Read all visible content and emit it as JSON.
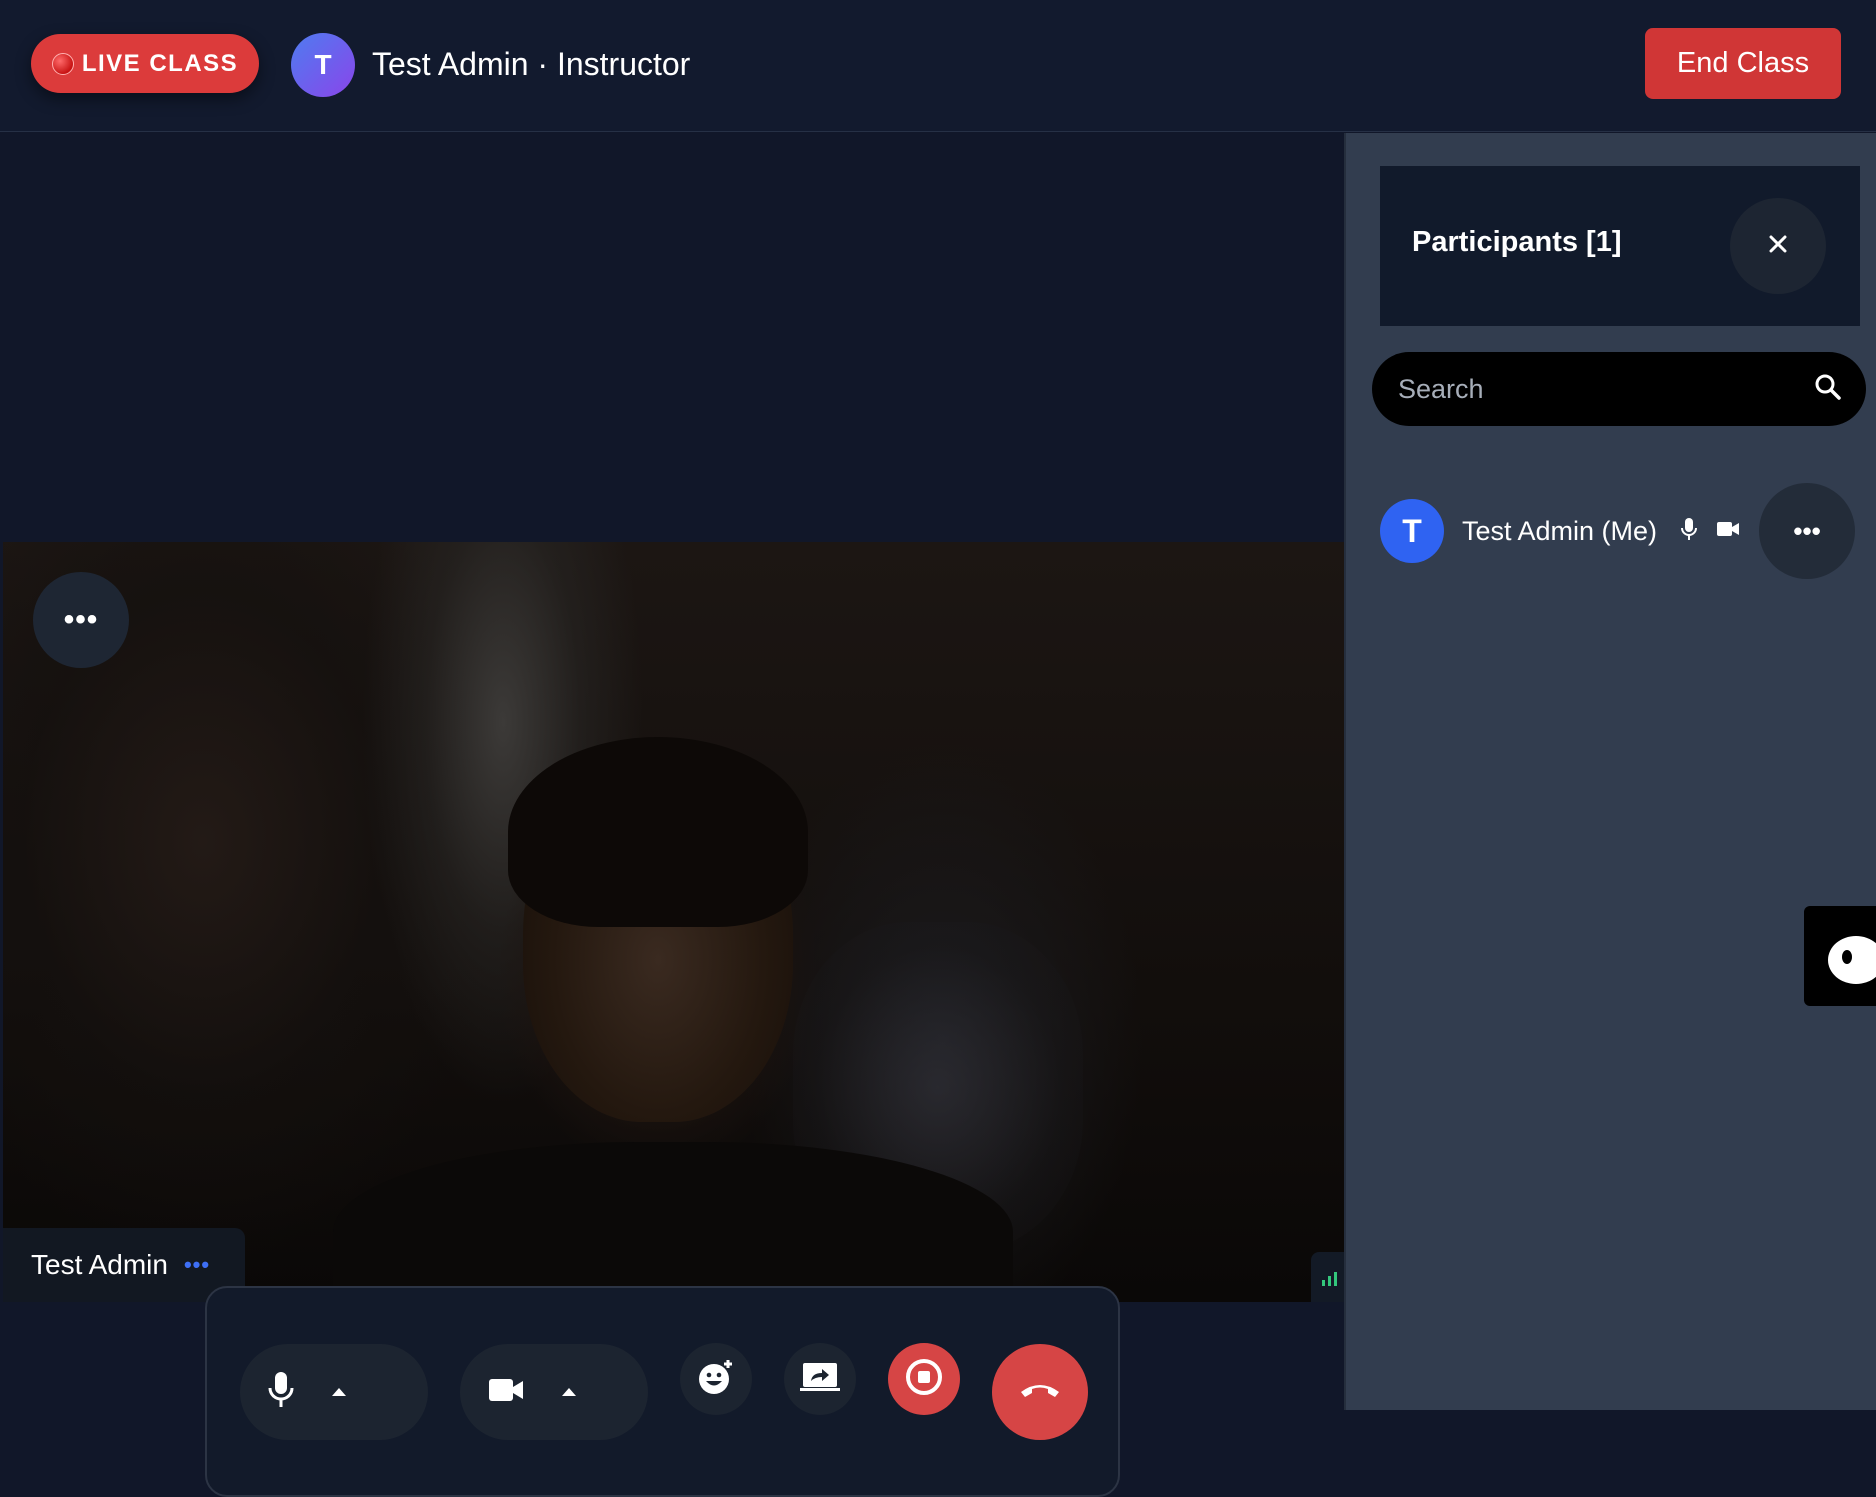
{
  "header": {
    "live_label": "LIVE CLASS",
    "avatar_initial": "T",
    "title": "Test Admin · Instructor",
    "end_class_label": "End Class"
  },
  "video": {
    "participant_name": "Test Admin",
    "menu_icon": "more-horizontal-icon",
    "name_menu_icon": "more-horizontal-icon",
    "signal_icon": "signal-strength-icon"
  },
  "controls": {
    "mic_icon": "microphone-icon",
    "mic_caret": "caret-up-icon",
    "camera_icon": "video-camera-icon",
    "camera_caret": "caret-up-icon",
    "reactions_icon": "emoji-add-icon",
    "share_icon": "screen-share-icon",
    "record_icon": "stop-record-icon",
    "leave_icon": "hang-up-icon"
  },
  "sidebar": {
    "title": "Participants [1]",
    "close_icon": "close-icon",
    "search_placeholder": "Search",
    "search_icon": "search-icon",
    "participants": [
      {
        "initial": "T",
        "name": "Test Admin (Me)",
        "mic_icon": "microphone-icon",
        "camera_icon": "video-camera-icon",
        "menu_icon": "more-horizontal-icon"
      }
    ]
  },
  "colors": {
    "live_red": "#dc3b3b",
    "end_class_red": "#d03636",
    "avatar_blue": "#2f63f2",
    "signal_green": "#33c77c"
  }
}
